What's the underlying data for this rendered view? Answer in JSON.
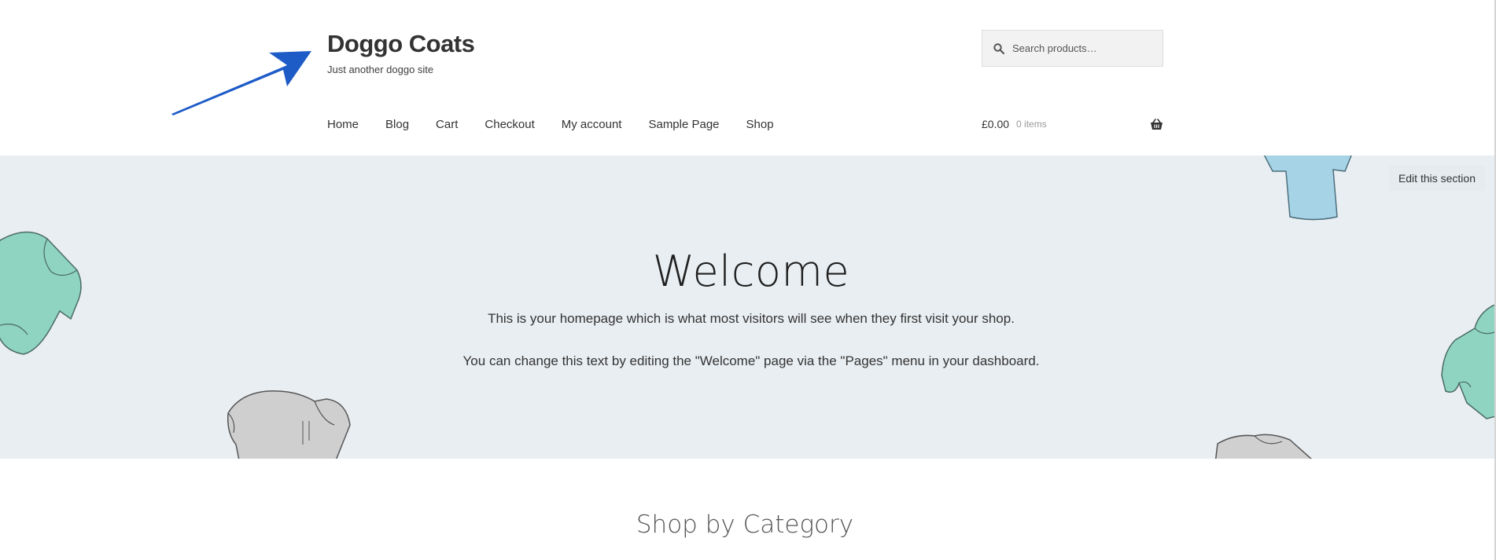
{
  "site": {
    "title": "Doggo Coats",
    "tagline": "Just another doggo site"
  },
  "search": {
    "placeholder": "Search products…",
    "icon": "search-icon"
  },
  "nav": {
    "items": [
      {
        "label": "Home"
      },
      {
        "label": "Blog"
      },
      {
        "label": "Cart"
      },
      {
        "label": "Checkout"
      },
      {
        "label": "My account"
      },
      {
        "label": "Sample Page"
      },
      {
        "label": "Shop"
      }
    ]
  },
  "cart": {
    "amount": "£0.00",
    "count": "0 items",
    "icon": "basket-icon"
  },
  "hero": {
    "edit_label": "Edit this section",
    "title": "Welcome",
    "line1": "This is your homepage which is what most visitors will see when they first visit your shop.",
    "line2": "You can change this text by editing the \"Welcome\" page via the \"Pages\" menu in your dashboard."
  },
  "category": {
    "title": "Shop by Category"
  },
  "colors": {
    "hero_bg": "#e9eef2",
    "arrow": "#1d5bc7",
    "mint": "#8fd4c0",
    "blue": "#a6d4e6",
    "gray": "#c9c9c9"
  }
}
